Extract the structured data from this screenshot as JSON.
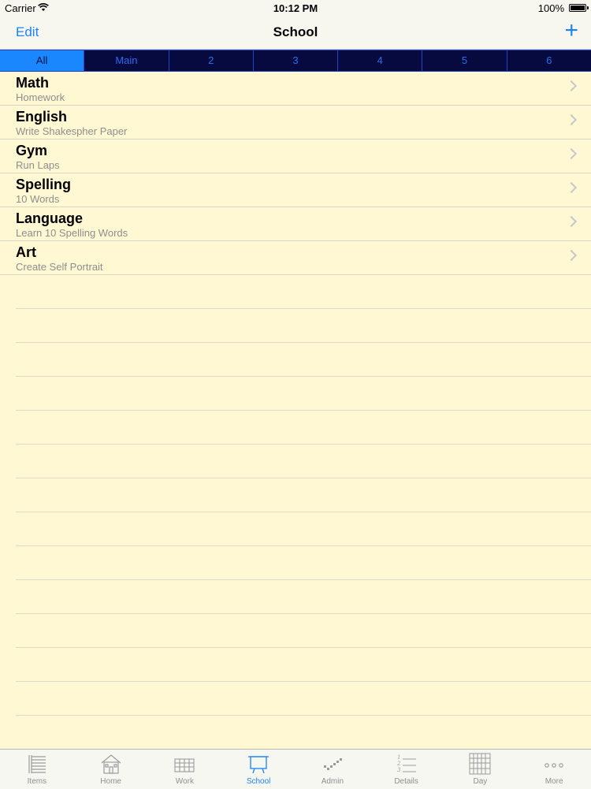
{
  "status": {
    "carrier": "Carrier",
    "time": "10:12 PM",
    "battery": "100%"
  },
  "nav": {
    "edit": "Edit",
    "title": "School",
    "add": "+"
  },
  "segments": [
    "All",
    "Main",
    "2",
    "3",
    "4",
    "5",
    "6"
  ],
  "active_segment": "All",
  "items": [
    {
      "title": "Math",
      "subtitle": "Homework"
    },
    {
      "title": "English",
      "subtitle": "Write Shakespher Paper"
    },
    {
      "title": "Gym",
      "subtitle": "Run Laps"
    },
    {
      "title": "Spelling",
      "subtitle": "10 Words"
    },
    {
      "title": "Language",
      "subtitle": "Learn 10 Spelling Words"
    },
    {
      "title": "Art",
      "subtitle": "Create Self Portrait"
    }
  ],
  "tabs": [
    {
      "label": "Items",
      "icon": "list-icon"
    },
    {
      "label": "Home",
      "icon": "house-icon"
    },
    {
      "label": "Work",
      "icon": "grid-icon"
    },
    {
      "label": "School",
      "icon": "chalkboard-icon"
    },
    {
      "label": "Admin",
      "icon": "check-icon"
    },
    {
      "label": "Details",
      "icon": "numbered-list-icon"
    },
    {
      "label": "Day",
      "icon": "calendar-icon"
    },
    {
      "label": "More",
      "icon": "more-icon"
    }
  ],
  "active_tab": "School",
  "colors": {
    "accent": "#1a82fb",
    "background": "#fff8d2",
    "segment_bg": "#060a3f"
  }
}
